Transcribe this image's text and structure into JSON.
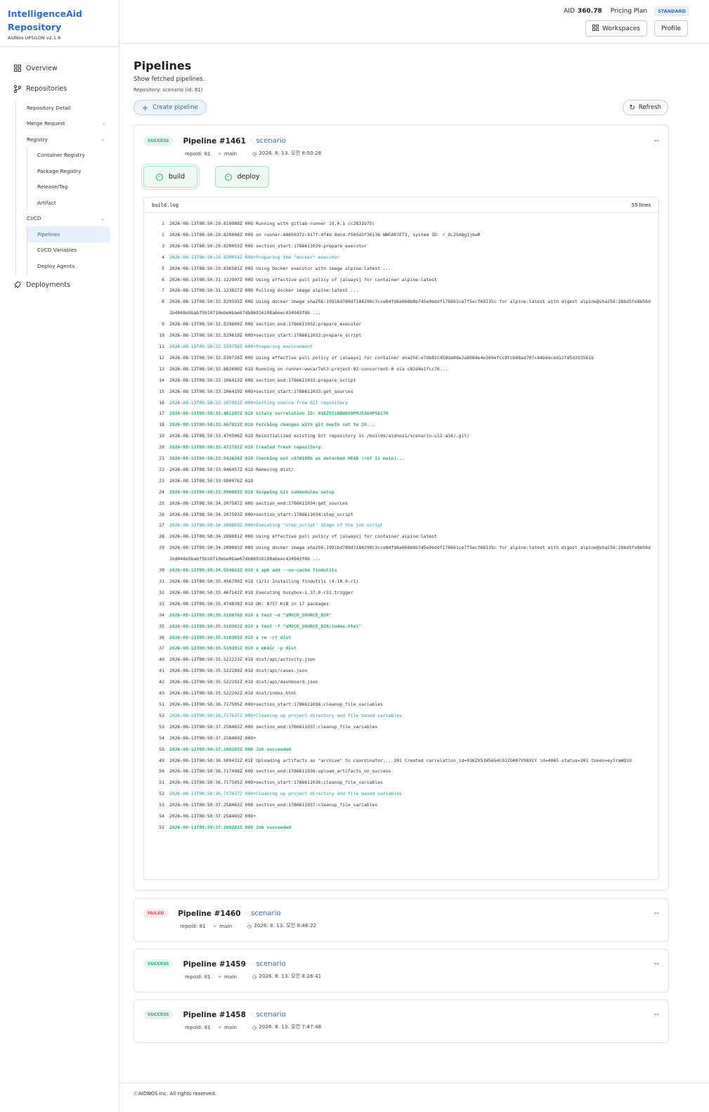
{
  "brand": {
    "title_line1": "IntelligenceAid",
    "title_line2": "Repository",
    "subtitle": "AidNos UPSILON v2.1.8"
  },
  "sidebar": {
    "overview": "Overview",
    "repositories": "Repositories",
    "repo_detail": "Repository Detail",
    "merge_request": "Merge Request",
    "registry": "Registry",
    "container_registry": "Container Registry",
    "package_registry": "Package Registry",
    "release_tag": "Release/Tag",
    "artifact": "Artifact",
    "cicd": "CI/CD",
    "pipelines": "Pipelines",
    "cicd_variables": "CI/CD Variables",
    "deploy_agents": "Deploy Agents",
    "deployments": "Deployments"
  },
  "header": {
    "aid_label": "AID",
    "aid_value": "360.78",
    "plan_label": "Pricing Plan",
    "plan_badge": "STANDARD",
    "workspaces": "Workspaces",
    "profile": "Profile"
  },
  "page": {
    "title": "Pipelines",
    "desc": "Show fetched pipelines.",
    "repo": "Repository: scenario  (id: 81)",
    "create": "Create pipeline",
    "refresh": "Refresh"
  },
  "pipelines": [
    {
      "status": "SUCCESS",
      "name": "Pipeline #1461",
      "project": "scenario",
      "repo": "repoId: 81",
      "branch": "main",
      "time": "2026. 8. 13. 오전 8:50:28",
      "more": "--"
    },
    {
      "status": "FAILED",
      "name": "Pipeline #1460",
      "project": "scenario",
      "repo": "repoId: 81",
      "branch": "main",
      "time": "2026. 8. 13. 오전 8:46:22",
      "more": "--"
    },
    {
      "status": "SUCCESS",
      "name": "Pipeline #1459",
      "project": "scenario",
      "repo": "repoId: 81",
      "branch": "main",
      "time": "2026. 8. 13. 오전 8:26:41",
      "more": "--"
    },
    {
      "status": "SUCCESS",
      "name": "Pipeline #1458",
      "project": "scenario",
      "repo": "repoId: 81",
      "branch": "main",
      "time": "2026. 8. 13. 오전 7:47:48",
      "more": "--"
    }
  ],
  "jobs": [
    "build",
    "deploy"
  ],
  "log": {
    "file": "build.log",
    "count": "55 lines",
    "lines": [
      [
        "1",
        "2026-08-13T08:50:29.819988Z 00O Running with gitlab-runner 19.0.1 (c2831b75)",
        ""
      ],
      [
        "2",
        "2026-08-13T08:50:29.820008Z 00O on runner-48850372-917f-4f4d-9dcd-f595d3f36136 WWCAR7ET3, system ID: r_OLZS4Qg1jbwR",
        ""
      ],
      [
        "3",
        "2026-08-13T08:50:29.820053Z 00O section_start:1786611029:prepare_executor",
        ""
      ],
      [
        "4",
        "2026-08-13T08:50:29.820054Z 00O+Preparing the \"docker\" executor",
        "c"
      ],
      [
        "5",
        "2026-08-13T08:50:29.836581Z 00O Using Docker executor with image alpine:latest ...",
        ""
      ],
      [
        "6",
        "2026-08-13T08:50:31.122997Z 00O Using effective pull policy of [always] for container alpine:latest",
        ""
      ],
      [
        "7",
        "2026-08-13T08:50:31.123827Z 00O Pulling docker image alpine:latest ...",
        ""
      ],
      [
        "8",
        "2026-08-13T08:50:32.529593Z 00O Using docker image sha256:1991bd789d7184290c3cce84fd6a068b8b745e9bddf178661ce7f5ecf68135c for alpine:latest with digest alpine@sha256:28bd5fe8b56d1bd048e5babf5b10710ebe0bae67db86916198a6eec434943f8b ...",
        ""
      ],
      [
        "9",
        "2026-08-13T08:50:32.529609Z 00O section_end:1786611032:prepare_executor",
        ""
      ],
      [
        "10",
        "2026-08-13T08:50:32.529610Z 00O+section_start:1786611032:prepare_script",
        ""
      ],
      [
        "11",
        "2026-08-13T08:50:32.529758Z 00O+Preparing environment",
        "c"
      ],
      [
        "12",
        "2026-08-13T08:50:32.530726Z 00O Using effective pull policy of [always] for container sha256:e7db82c458da0de2a8084e4e369efcc8fcb68ad707c44bdaced12fd5d293561b",
        ""
      ],
      [
        "13",
        "2026-08-13T08:50:32.882600Z 01O Running on runner-wwcar7et3-project-92-concurrent-0 via c82d4e1fcc76...",
        ""
      ],
      [
        "14",
        "2026-08-13T08:50:33.106413Z 00O section_end:1786611033:prepare_script",
        ""
      ],
      [
        "15",
        "2026-08-13T08:50:33.106419Z 00O+section_start:1786611033:get_sources",
        ""
      ],
      [
        "16",
        "2026-08-13T08:50:33.107051Z 00O+Getting source from Git repository",
        "c"
      ],
      [
        "17",
        "2026-08-13T08:50:33.461297Z 01O Gitaly correlation ID: 01KZX51NBW6G9PMJEA64P561TH",
        "g"
      ],
      [
        "18",
        "2026-08-13T08:50:33.467813Z 01O Fetching changes with git depth set to 20...",
        "g"
      ],
      [
        "19",
        "2026-08-13T08:50:33.470506Z 01O Reinitialized existing Git repository in /builds/aidnos1/scenario-u12-a34/.git/",
        ""
      ],
      [
        "20",
        "2026-08-13T08:50:33.472782Z 01O Created fresh repository.",
        "g"
      ],
      [
        "21",
        "2026-08-13T08:50:33.942026Z 01O Checking out c070108b as detached HEAD (ref is main)...",
        "g"
      ],
      [
        "22",
        "2026-08-13T08:50:33.946457Z 01O Removing dist/",
        ""
      ],
      [
        "23",
        "2026-08-13T08:50:33.990076Z 01O",
        ""
      ],
      [
        "24",
        "2026-08-13T08:50:33.990083Z 01O Skipping Git submodules setup",
        "g"
      ],
      [
        "25",
        "2026-08-13T08:50:34.207587Z 00O section_end:1786611034:get_sources",
        ""
      ],
      [
        "26",
        "2026-08-13T08:50:34.207593Z 00O+section_start:1786611034:step_script",
        ""
      ],
      [
        "27",
        "2026-08-13T08:50:34.208859Z 00O+Executing \"step_script\" stage of the job script",
        "c"
      ],
      [
        "28",
        "2026-08-13T08:50:34.208881Z 00O Using effective pull policy of [always] for container alpine:latest",
        ""
      ],
      [
        "29",
        "2026-08-13T08:50:34.209803Z 00O Using docker image sha256:1991bd789d7184290c3cce84fd6a068b8b745e9bddf178661ce7f5ecf68135c for alpine:latest with digest alpine@sha256:28bd5fe8b56d1bd048e5babf5b10710ebe0bae67db86916198a6eec434943f8b ...",
        ""
      ],
      [
        "30",
        "2026-08-13T08:50:34.554023Z 01O $ apk add --no-cache findutils",
        "g"
      ],
      [
        "31",
        "2026-08-13T08:50:35.456799Z 01O (1/1) Installing findutils (4.10.0-r1)",
        ""
      ],
      [
        "32",
        "2026-08-13T08:50:35.467142Z 01O Executing busybox-1.37.0-r31.trigger",
        ""
      ],
      [
        "33",
        "2026-08-13T08:50:35.474839Z 01O OK: 8757 KiB in 17 packages",
        ""
      ],
      [
        "34",
        "2026-08-13T08:50:35.518076Z 01O $ test -d \"$MOCK_SOURCE_DIR\"",
        "g"
      ],
      [
        "35",
        "2026-08-13T08:50:35.518382Z 01O $ test -f \"$MOCK_SOURCE_DIR/index.html\"",
        "g"
      ],
      [
        "36",
        "2026-08-13T08:50:35.518385Z 01O $ rm -rf dist",
        "g"
      ],
      [
        "37",
        "2026-08-13T08:50:35.519391Z 01O $ mkdir -p dist",
        "g"
      ],
      [
        "40",
        "2026-08-13T08:50:35.522223Z 01O dist/api/activity.json",
        ""
      ],
      [
        "41",
        "2026-08-13T08:50:35.522289Z 01O dist/api/cases.json",
        ""
      ],
      [
        "42",
        "2026-08-13T08:50:35.522291Z 01O dist/api/dashboard.json",
        ""
      ],
      [
        "43",
        "2026-08-13T08:50:35.522292Z 01O dist/index.html",
        ""
      ],
      [
        "51",
        "2026-08-13T08:50:36.717505Z 00O+section_start:1786611036:cleanup_file_variables",
        ""
      ],
      [
        "52",
        "2026-08-13T08:50:36.717637Z 00O+Cleaning up project directory and file based variables",
        "c"
      ],
      [
        "53",
        "2026-08-13T08:50:37.258463Z 00O section_end:1786611037:cleanup_file_variables",
        ""
      ],
      [
        "54",
        "2026-08-13T08:50:37.258469Z 00O+",
        ""
      ],
      [
        "55",
        "2026-08-13T08:50:37.268283Z 00O Job succeeded",
        "g"
      ],
      [
        "49",
        "2026-08-13T08:50:36.509431Z 01E Uploading artifacts as \"archive\" to coordinator... 201 Created correlation_id=01KZX51W5654C0JZGH07V98XCY id=4065 status=201 token=ey3raWQiO",
        ""
      ],
      [
        "50",
        "2026-08-13T08:50:36.717498Z 00O section_end:1786611036:upload_artifacts_on_success",
        ""
      ],
      [
        "51",
        "2026-08-13T08:50:36.717505Z 00O+section_start:1786611036:cleanup_file_variables",
        ""
      ],
      [
        "52",
        "2026-08-13T08:50:36.717637Z 00O+Cleaning up project directory and file based variables",
        "c"
      ],
      [
        "53",
        "2026-08-13T08:50:37.258463Z 00O section_end:1786611037:cleanup_file_variables",
        ""
      ],
      [
        "54",
        "2026-08-13T08:50:37.258469Z 00O+",
        ""
      ],
      [
        "55",
        "2026-08-13T08:50:37.268283Z 00O Job succeeded",
        "g"
      ]
    ]
  },
  "footer": "ⓒAIDNOS Inc. All rights reserved."
}
